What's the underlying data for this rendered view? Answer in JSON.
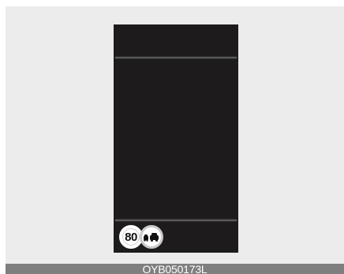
{
  "display": {
    "speed_limit_value": "80",
    "speed_limit_sign_icon": "speed-limit-sign",
    "overtaking_sign_icon": "no-overtaking-sign"
  },
  "caption": {
    "code": "OYB050173L"
  },
  "colors": {
    "page_background": "#ececec",
    "panel_background": "#1d1b1c",
    "divider": "#5b5b5b",
    "caption_bar": "#7f7f7f",
    "sign_face": "#ffffff",
    "sign_symbol": "#111111"
  }
}
